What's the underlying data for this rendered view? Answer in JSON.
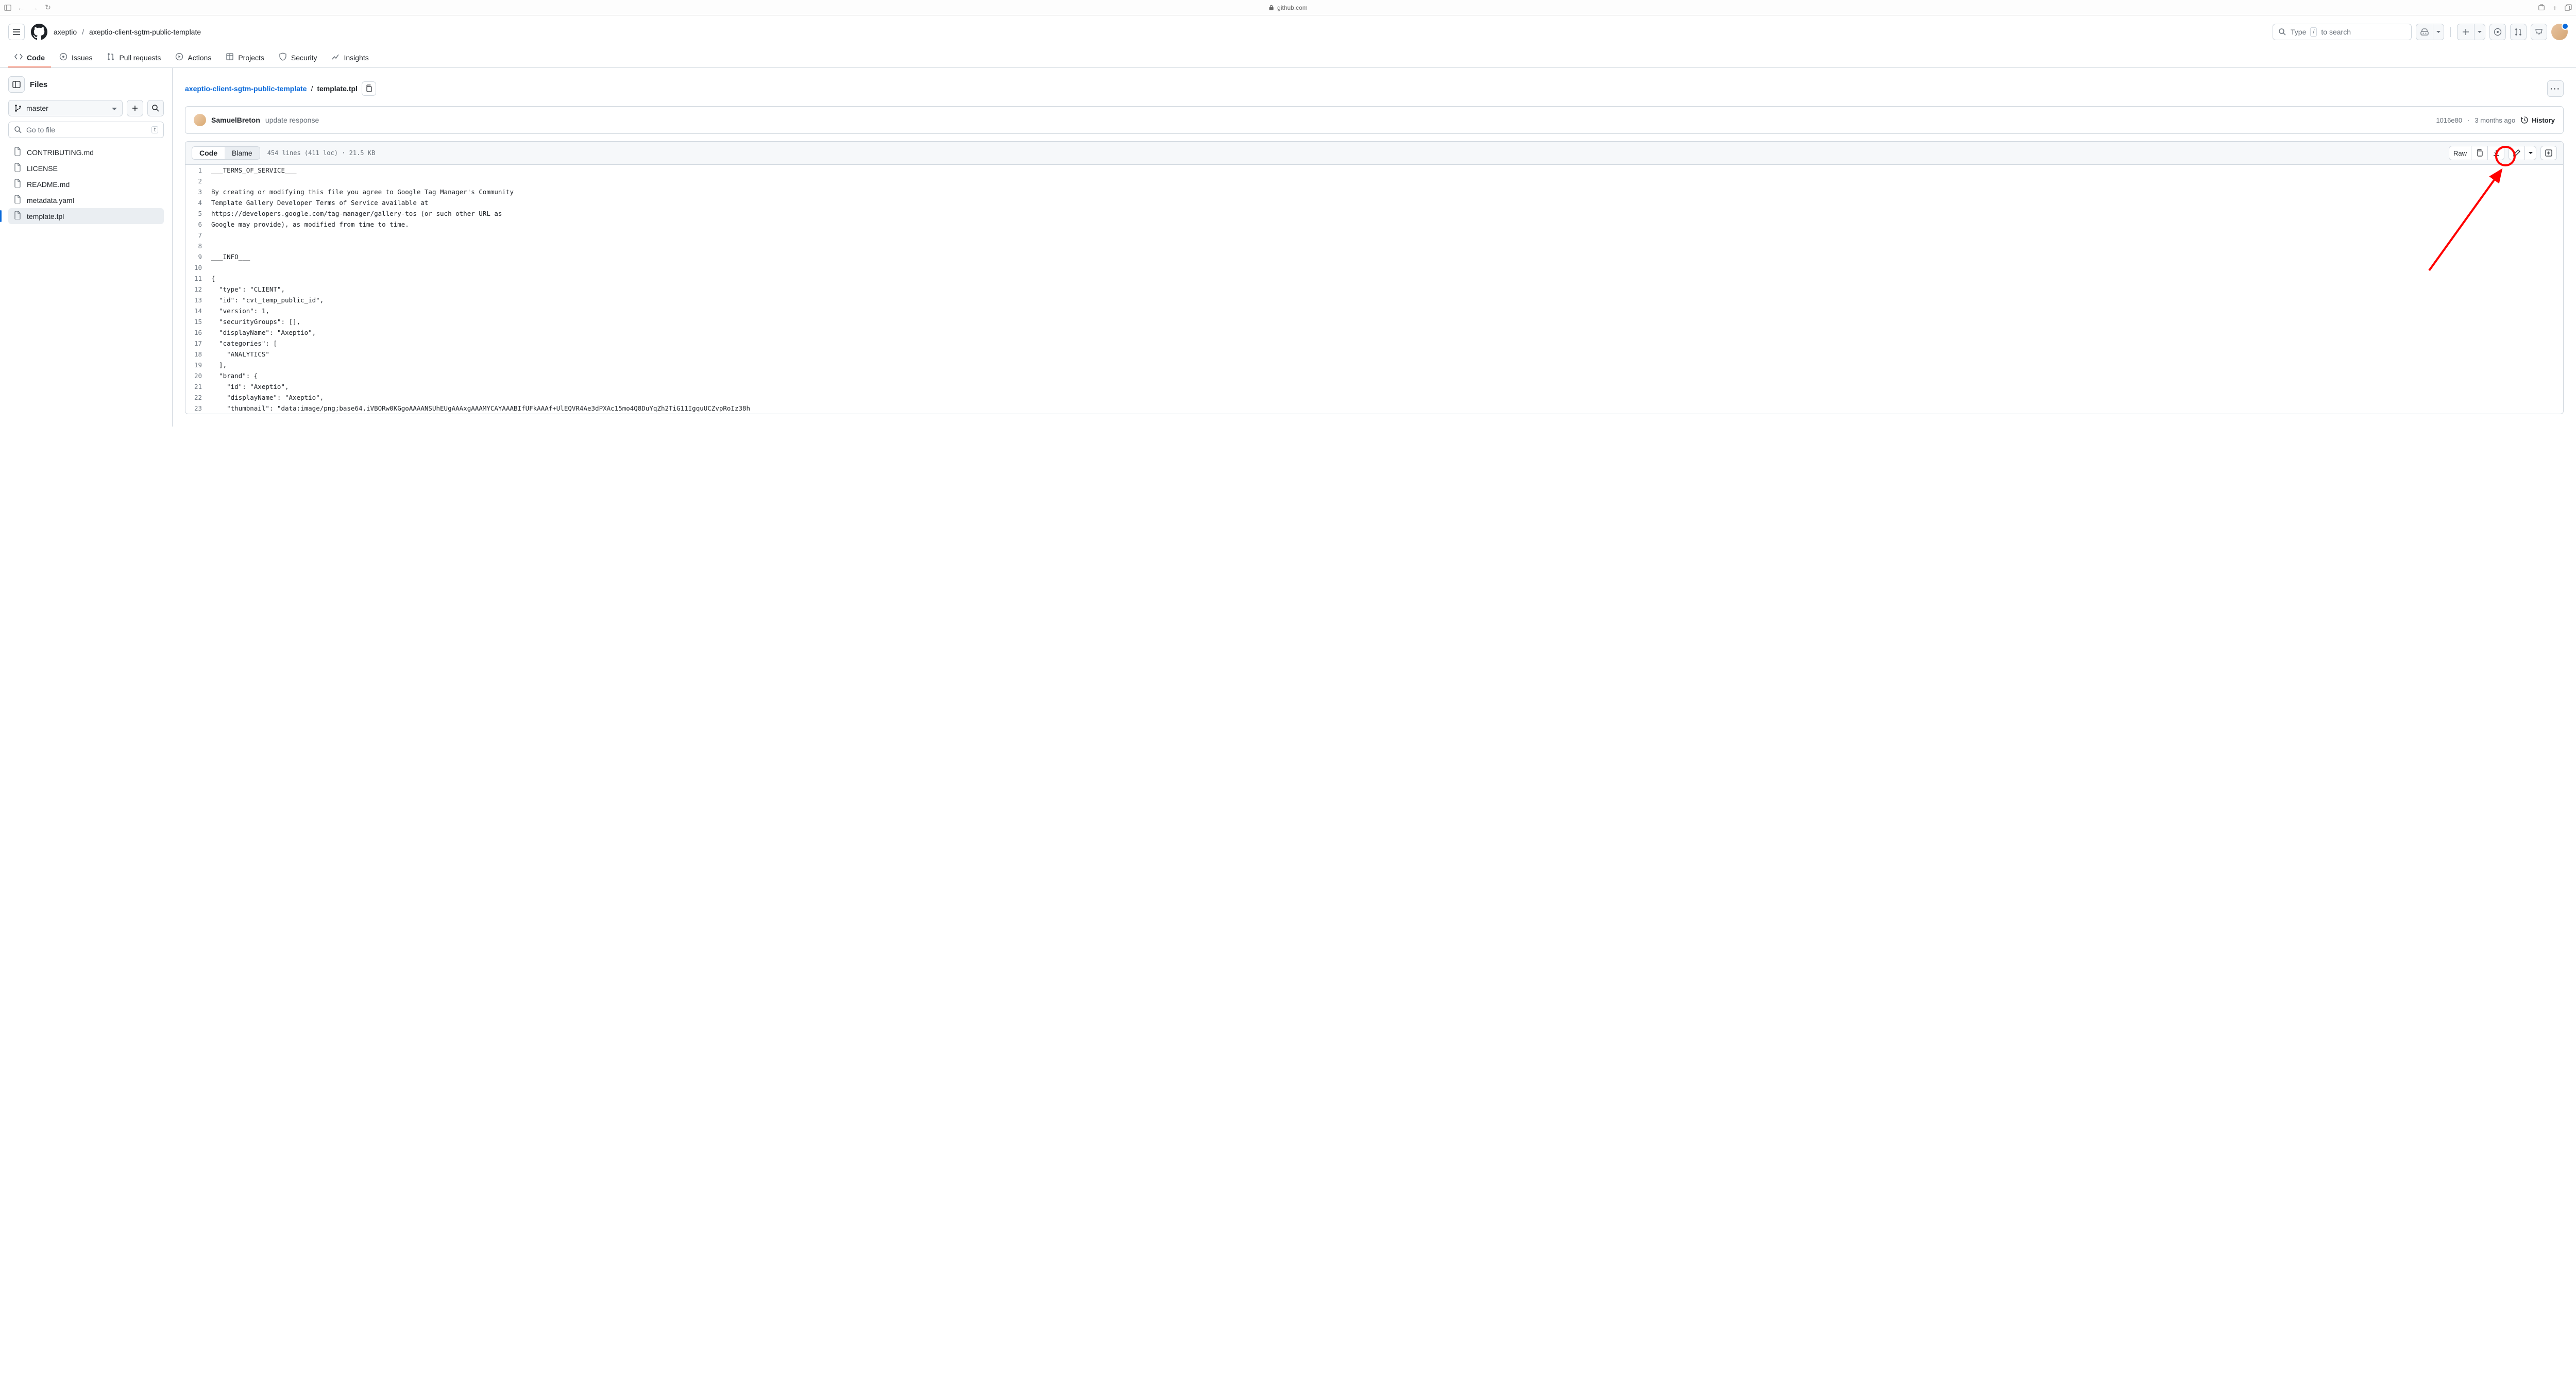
{
  "browser": {
    "url": "github.com"
  },
  "header": {
    "owner": "axeptio",
    "sep": "/",
    "repo": "axeptio-client-sgtm-public-template",
    "search_prefix": "Type",
    "search_kbd": "/",
    "search_suffix": "to search"
  },
  "tabs": [
    {
      "icon": "code",
      "label": "Code",
      "active": true
    },
    {
      "icon": "issue",
      "label": "Issues"
    },
    {
      "icon": "pr",
      "label": "Pull requests"
    },
    {
      "icon": "play",
      "label": "Actions"
    },
    {
      "icon": "table",
      "label": "Projects"
    },
    {
      "icon": "shield",
      "label": "Security"
    },
    {
      "icon": "graph",
      "label": "Insights"
    }
  ],
  "sidebar": {
    "title": "Files",
    "branch": "master",
    "gotofile": "Go to file",
    "gotofile_kbd": "t",
    "files": [
      {
        "name": "CONTRIBUTING.md"
      },
      {
        "name": "LICENSE"
      },
      {
        "name": "README.md"
      },
      {
        "name": "metadata.yaml"
      },
      {
        "name": "template.tpl",
        "active": true
      }
    ]
  },
  "path": {
    "repo": "axeptio-client-sgtm-public-template",
    "sep": "/",
    "file": "template.tpl"
  },
  "commit": {
    "author": "SamuelBreton",
    "message": "update response",
    "sha": "1016e80",
    "dot": "·",
    "ago": "3 months ago",
    "history": "History"
  },
  "toolbar": {
    "code": "Code",
    "blame": "Blame",
    "meta": "454 lines (411 loc) · 21.5 KB",
    "raw": "Raw"
  },
  "code": [
    "___TERMS_OF_SERVICE___",
    "",
    "By creating or modifying this file you agree to Google Tag Manager's Community",
    "Template Gallery Developer Terms of Service available at",
    "https://developers.google.com/tag-manager/gallery-tos (or such other URL as",
    "Google may provide), as modified from time to time.",
    "",
    "",
    "___INFO___",
    "",
    "{",
    "  \"type\": \"CLIENT\",",
    "  \"id\": \"cvt_temp_public_id\",",
    "  \"version\": 1,",
    "  \"securityGroups\": [],",
    "  \"displayName\": \"Axeptio\",",
    "  \"categories\": [",
    "    \"ANALYTICS\"",
    "  ],",
    "  \"brand\": {",
    "    \"id\": \"Axeptio\",",
    "    \"displayName\": \"Axeptio\",",
    "    \"thumbnail\": \"data:image/png;base64,iVBORw0KGgoAAAANSUhEUgAAAxgAAAMYCAYAAABIfUFkAAAf+UlEQVR4Ae3dPXAc15mo4Q8DuYqZh2TiG11IgquUCZvpRoIz38h"
  ]
}
